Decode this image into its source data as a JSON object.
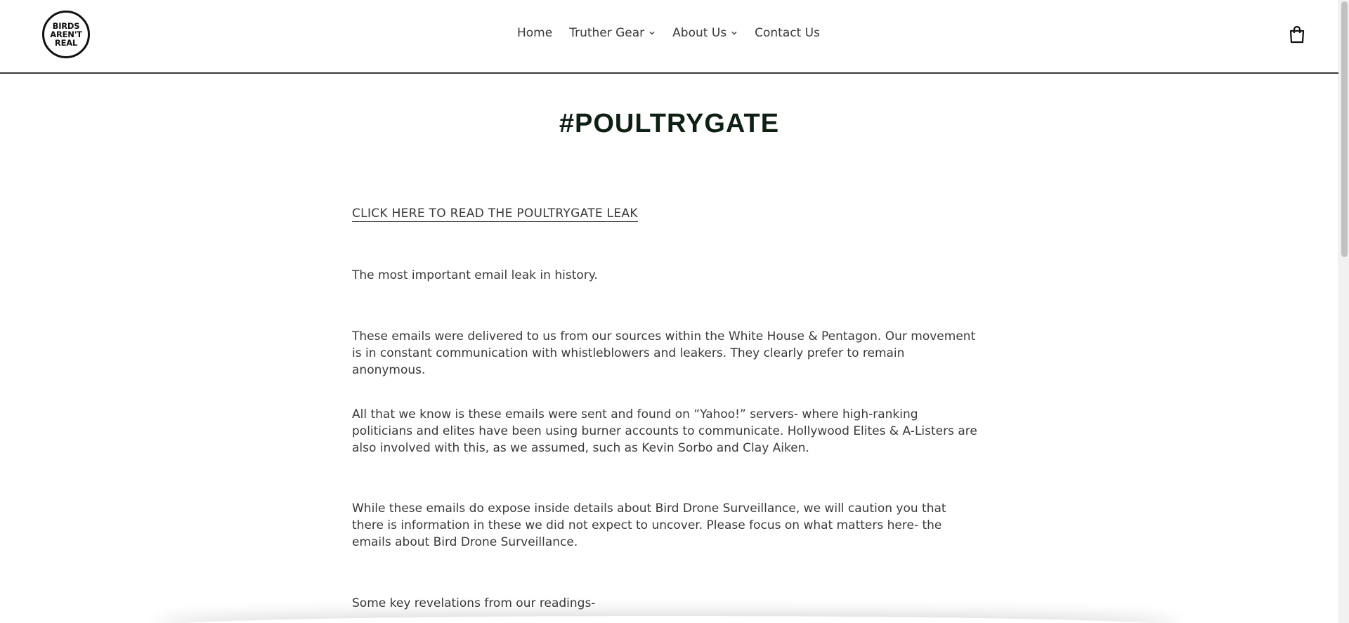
{
  "header": {
    "logo": {
      "line1": "BIRDS",
      "line2": "AREN'T",
      "line3": "REAL"
    },
    "nav": [
      {
        "label": "Home",
        "has_dropdown": false
      },
      {
        "label": "Truther Gear",
        "has_dropdown": true
      },
      {
        "label": "About Us",
        "has_dropdown": true
      },
      {
        "label": "Contact Us",
        "has_dropdown": false
      }
    ],
    "cart_icon": "shopping-bag-icon"
  },
  "main": {
    "title": "#POULTRYGATE",
    "leak_link": "CLICK HERE TO READ THE POULTRYGATE LEAK",
    "paragraphs": [
      "The most important email leak in history.",
      "These emails were delivered to us from our sources within the White House & Pentagon. Our movement is in constant communication with whistleblowers and leakers. They clearly prefer to remain anonymous.",
      "All that we know is these emails were sent and found on “Yahoo!” servers- where high-ranking politicians and elites have been using burner accounts to communicate. Hollywood Elites & A-Listers are also involved with this, as we assumed, such as Kevin Sorbo and Clay Aiken.",
      "While these emails do expose inside details about Bird Drone Surveillance, we will caution you that there is information in these we did not expect to uncover. Please focus on what matters here- the emails about Bird Drone Surveillance.",
      "Some key revelations from our readings-"
    ]
  },
  "colors": {
    "text": "#3a3a3a",
    "title": "#0f1f14",
    "background": "#ffffff"
  }
}
